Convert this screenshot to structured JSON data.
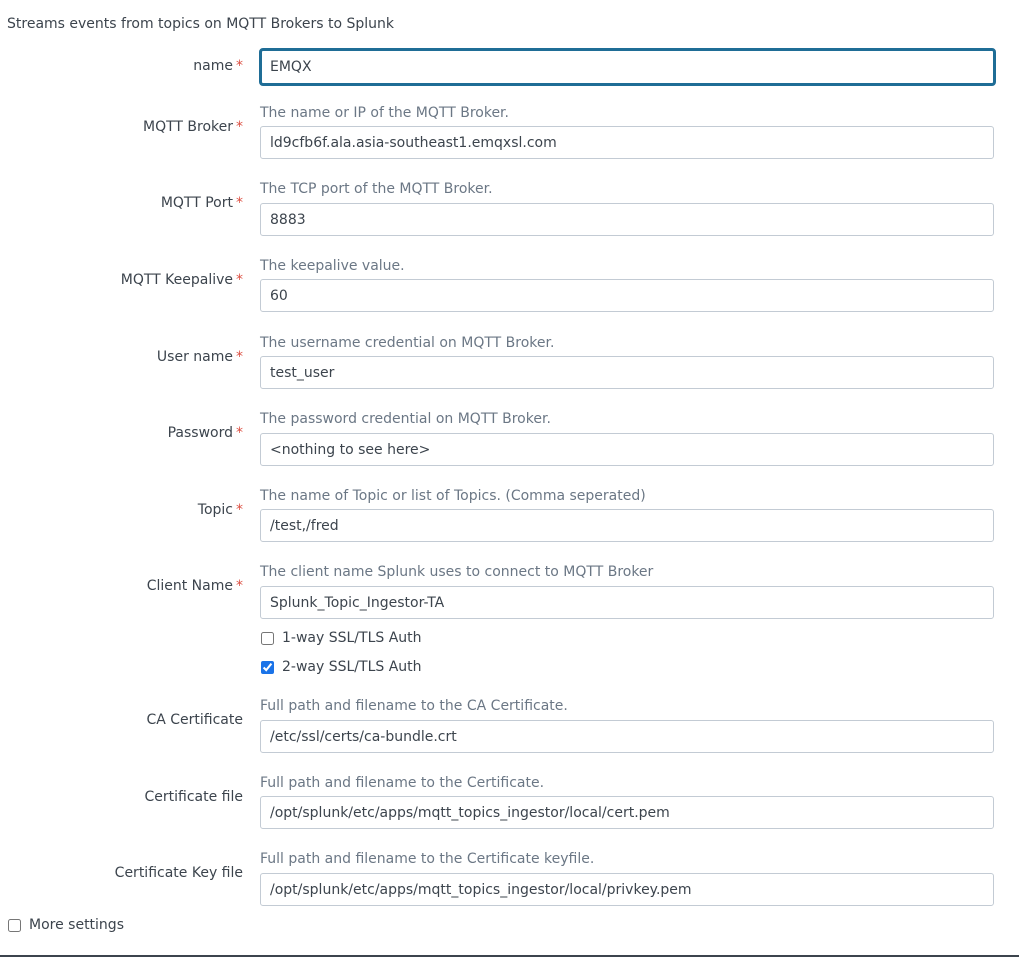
{
  "form": {
    "description": "Streams events from topics on MQTT Brokers to Splunk",
    "required_marker": "*",
    "fields": {
      "name": {
        "label": "name",
        "value": "EMQX"
      },
      "broker": {
        "label": "MQTT Broker",
        "help": "The name or IP of the MQTT Broker.",
        "value": "ld9cfb6f.ala.asia-southeast1.emqxsl.com"
      },
      "port": {
        "label": "MQTT Port",
        "help": "The TCP port of the MQTT Broker.",
        "value": "8883"
      },
      "keepalive": {
        "label": "MQTT Keepalive",
        "help": "The keepalive value.",
        "value": "60"
      },
      "username": {
        "label": "User name",
        "help": "The username credential on MQTT Broker.",
        "value": "test_user"
      },
      "password": {
        "label": "Password",
        "help": "The password credential on MQTT Broker.",
        "value": "<nothing to see here>"
      },
      "topic": {
        "label": "Topic",
        "help": "The name of Topic or list of Topics. (Comma seperated)",
        "value": "/test,/fred"
      },
      "client_name": {
        "label": "Client Name",
        "help": "The client name Splunk uses to connect to MQTT Broker",
        "value": "Splunk_Topic_Ingestor-TA"
      },
      "ssl_one_way": {
        "label": "1-way SSL/TLS Auth",
        "checked": false
      },
      "ssl_two_way": {
        "label": "2-way SSL/TLS Auth",
        "checked": true
      },
      "ca_cert": {
        "label": "CA Certificate",
        "help": "Full path and filename to the CA Certificate.",
        "value": "/etc/ssl/certs/ca-bundle.crt"
      },
      "cert_file": {
        "label": "Certificate file",
        "help": "Full path and filename to the Certificate.",
        "value": "/opt/splunk/etc/apps/mqtt_topics_ingestor/local/cert.pem"
      },
      "cert_key_file": {
        "label": "Certificate Key file",
        "help": "Full path and filename to the Certificate keyfile.",
        "value": "/opt/splunk/etc/apps/mqtt_topics_ingestor/local/privkey.pem"
      }
    },
    "more_settings": {
      "label": "More settings",
      "checked": false
    }
  },
  "colors": {
    "required": "#dc4e41",
    "focus_border": "#1f6d96",
    "input_border": "#c3cbd4",
    "help_text": "#6b7785",
    "text": "#3c444d"
  }
}
